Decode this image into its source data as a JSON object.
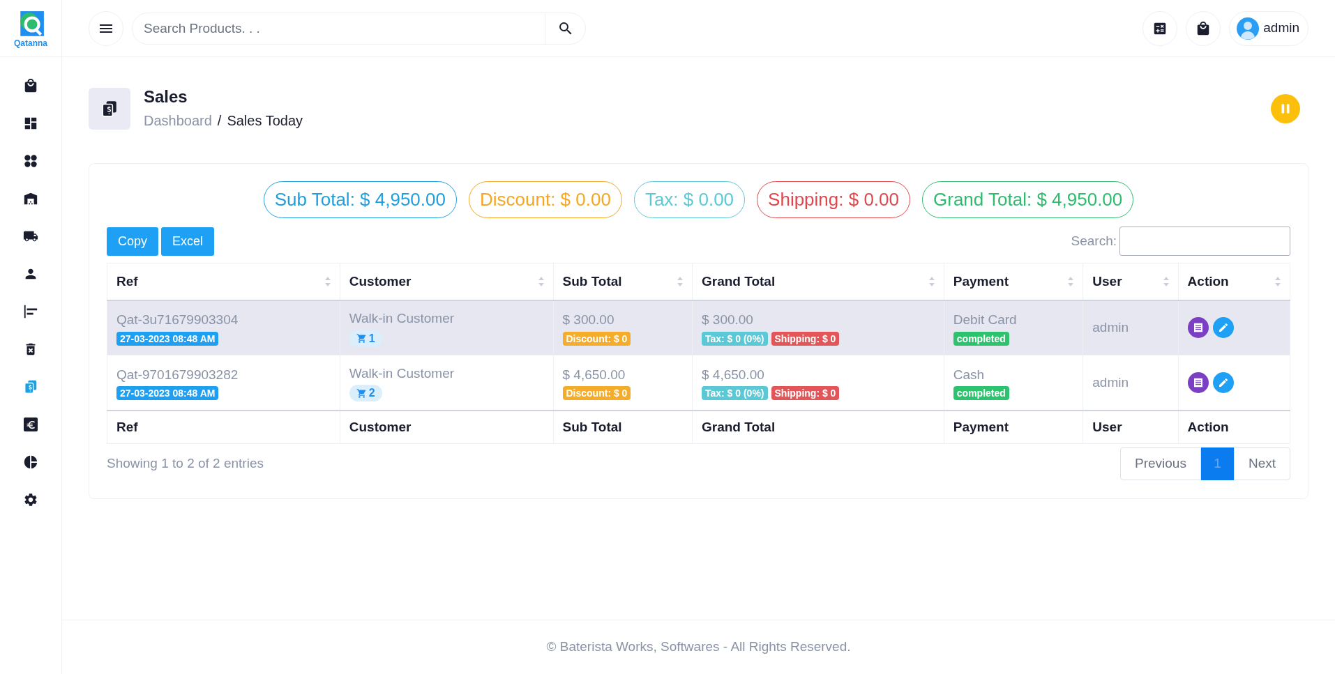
{
  "logo": {
    "text": "Qatanna"
  },
  "sidebar": {
    "items": [
      {
        "selected": false
      },
      {
        "selected": false
      },
      {
        "selected": false
      },
      {
        "selected": false
      },
      {
        "selected": false
      },
      {
        "selected": false
      },
      {
        "selected": false
      },
      {
        "selected": false
      },
      {
        "selected": true
      },
      {
        "selected": false
      },
      {
        "selected": false
      },
      {
        "selected": false
      }
    ]
  },
  "header": {
    "search": {
      "placeholder": "Search Products. . ."
    },
    "user": "admin"
  },
  "page": {
    "title": "Sales",
    "breadcrumb": [
      "Dashboard",
      "Sales Today"
    ],
    "separator": "/"
  },
  "summary": [
    {
      "text": "Sub Total: $ 4,950.00",
      "color": "#1e9fe0"
    },
    {
      "text": "Discount: $ 0.00",
      "color": "#f5a623"
    },
    {
      "text": "Tax: $ 0.00",
      "color": "#5bc8d6"
    },
    {
      "text": "Shipping: $ 0.00",
      "color": "#e0474c"
    },
    {
      "text": "Grand Total: $ 4,950.00",
      "color": "#2dbb6e"
    }
  ],
  "export_buttons": [
    "Copy",
    "Excel"
  ],
  "search": {
    "label": "Search:"
  },
  "table": {
    "columns": [
      "Ref",
      "Customer",
      "Sub Total",
      "Grand Total",
      "Payment",
      "User",
      "Action"
    ],
    "rows": [
      {
        "selected": true,
        "ref": "Qat-3u71679903304",
        "date": "27-03-2023 08:48 AM",
        "customer": "Walk-in Customer",
        "items": "1",
        "sub_total": "$ 300.00",
        "discount": "Discount: $ 0",
        "grand_total": "$ 300.00",
        "tax": "Tax: $ 0 (0%)",
        "shipping": "Shipping: $ 0",
        "payment": "Debit Card",
        "status": "completed",
        "user": "admin"
      },
      {
        "selected": false,
        "ref": "Qat-9701679903282",
        "date": "27-03-2023 08:48 AM",
        "customer": "Walk-in Customer",
        "items": "2",
        "sub_total": "$ 4,650.00",
        "discount": "Discount: $ 0",
        "grand_total": "$ 4,650.00",
        "tax": "Tax: $ 0 (0%)",
        "shipping": "Shipping: $ 0",
        "payment": "Cash",
        "status": "completed",
        "user": "admin"
      }
    ],
    "footer": [
      "Ref",
      "Customer",
      "Sub Total",
      "Grand Total",
      "Payment",
      "User",
      "Action"
    ]
  },
  "info": "Showing 1 to 2 of 2 entries",
  "pagination": {
    "previous": "Previous",
    "pages": [
      {
        "label": "1",
        "selected": true
      }
    ],
    "next": "Next"
  },
  "footer": "© Baterista Works, Softwares - All Rights Reserved."
}
